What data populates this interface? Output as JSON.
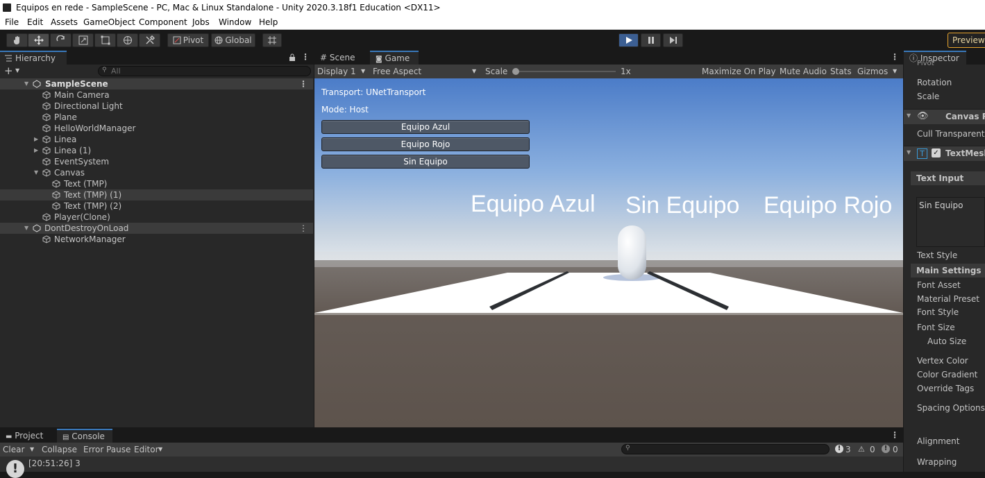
{
  "window": {
    "title": "Equipos en rede - SampleScene - PC, Mac & Linux Standalone - Unity 2020.3.18f1 Education <DX11>"
  },
  "menu": [
    "File",
    "Edit",
    "Assets",
    "GameObject",
    "Component",
    "Jobs",
    "Window",
    "Help"
  ],
  "toolbar": {
    "pivot": "Pivot",
    "global": "Global",
    "preview": "Preview"
  },
  "hierarchy": {
    "tab": "Hierarchy",
    "search_placeholder": "All",
    "rows": [
      {
        "label": "SampleScene",
        "kind": "scene"
      },
      {
        "label": "Main Camera"
      },
      {
        "label": "Directional Light"
      },
      {
        "label": "Plane"
      },
      {
        "label": "HelloWorldManager"
      },
      {
        "label": "Linea"
      },
      {
        "label": "Linea  (1)"
      },
      {
        "label": "EventSystem"
      },
      {
        "label": "Canvas"
      },
      {
        "label": "Text (TMP)"
      },
      {
        "label": "Text (TMP) (1)"
      },
      {
        "label": "Text (TMP) (2)"
      },
      {
        "label": "Player(Clone)"
      },
      {
        "label": "DontDestroyOnLoad",
        "kind": "scene"
      },
      {
        "label": "NetworkManager"
      }
    ]
  },
  "game": {
    "tabs": [
      "Scene",
      "Game"
    ],
    "display": "Display 1",
    "aspect": "Free Aspect",
    "scale_label": "Scale",
    "scale_value": "1x",
    "options": [
      "Maximize On Play",
      "Mute Audio",
      "Stats",
      "Gizmos"
    ],
    "transport": "Transport: UNetTransport",
    "mode": "Mode: Host",
    "buttons": [
      "Equipo Azul",
      "Equipo Rojo",
      "Sin Equipo"
    ],
    "world_labels": [
      "Equipo Azul",
      "Sin Equipo",
      "Equipo Rojo"
    ]
  },
  "inspector": {
    "tab": "Inspector",
    "pivot_partial": "Pivot",
    "rotation": "Rotation",
    "scale": "Scale",
    "canvas_renderer": "Canvas Re",
    "cull_transparent": "Cull Transparent M",
    "textmesh": "TextMesh",
    "text_input_header": "Text Input",
    "text_input_value": "Sin Equipo",
    "text_style": "Text Style",
    "main_settings": "Main Settings",
    "fields": [
      "Font Asset",
      "Material Preset",
      "Font Style",
      "Font Size",
      "Auto Size",
      "Vertex Color",
      "Color Gradient",
      "Override Tags",
      "Spacing Options (",
      "Alignment",
      "Wrapping"
    ]
  },
  "console": {
    "tabs": [
      "Project",
      "Console"
    ],
    "buttons": [
      "Clear",
      "Collapse",
      "Error Pause",
      "Editor"
    ],
    "counts": {
      "info": "3",
      "warn": "0",
      "error": "0"
    },
    "log_time": "[20:51:26] 3"
  }
}
